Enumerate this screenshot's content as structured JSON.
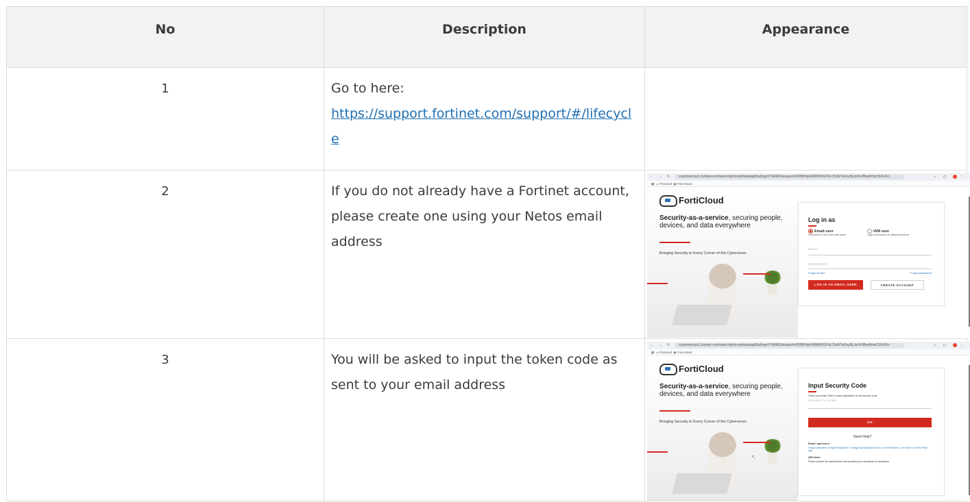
{
  "table": {
    "headers": [
      "No",
      "Description",
      "Appearance"
    ],
    "rows": [
      {
        "no": "1",
        "desc_prefix": "Go to here:",
        "link": "https://support.fortinet.com/support/#/lifecycle"
      },
      {
        "no": "2",
        "desc": "If you do not already have a Fortinet account, please create one using your Netos email address"
      },
      {
        "no": "3",
        "desc": "You will be asked to input the token code as sent to your email address"
      }
    ]
  },
  "shot_common": {
    "url": "customersso1.fortinet.com/saml-idp/mvdyt4ujwkgkf6a/login/?SAMLRequest=tZRf9HkeFMWtR%2FfuT3xNiTw2vyNLdn%2BiwAHwOS%2Fn",
    "bm_personal": "Personal",
    "bm_free": "Free Music",
    "logo": "FortiCloud",
    "tagline_bold": "Security-as-a-service",
    "tagline_rest": ", securing people, devices, and data everywhere",
    "subtitle": "Bringing Security to Every Corner of the Cyberverse."
  },
  "shot_login": {
    "heading": "Log in as",
    "email_user": "Email user",
    "email_user_sub": "Org Admin or Sub Users with email",
    "iam_user": "IAM user",
    "iam_user_sub": "Login with Account ID (letters/numbers)",
    "email_label": "EMAIL",
    "password_label": "PASSWORD",
    "forgot_email": "Forgot Email?",
    "forgot_password": "Forgot password?",
    "login_button": "LOG IN AS EMAIL USER",
    "create_button": "CREATE ACCOUNT"
  },
  "shot_code": {
    "heading": "Input Security Code",
    "instruction": "Check your email, SMS or token application for the security code.",
    "code_label": "SECURITY CODE",
    "go_button": "GO",
    "need_help": "Need Help?",
    "email_users": "Email Login Users:",
    "help_links": "Forgot Username | Forgot Password? | Change My Security Device | Lost FortiToken | Lost Token on Third Party App",
    "iam_users": "IAM Users:",
    "iam_help": "Please contact the administrator that provided your username for assistance."
  }
}
